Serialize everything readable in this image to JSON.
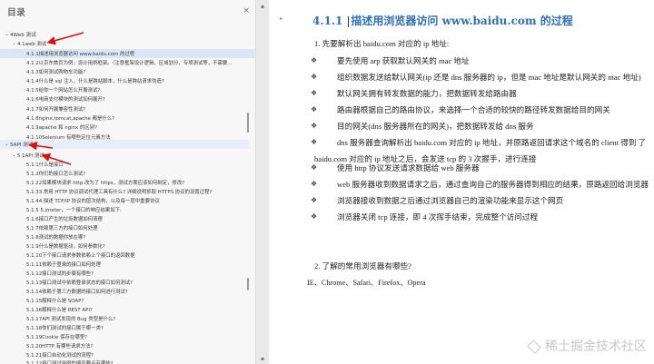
{
  "sidebar": {
    "title": "目录",
    "close_glyph": "×",
    "items": [
      {
        "label": "4Web 测试",
        "level": 1,
        "twisty": "v",
        "selected": false
      },
      {
        "label": "4.1web 测试",
        "level": 2,
        "twisty": "v",
        "selected": false
      },
      {
        "label": "4.1.1描述用浏览器访问 www.baidu.com 的过程",
        "level": 3,
        "twisty": "",
        "selected": true
      },
      {
        "label": "4.1.2以京东首页为例，设计用例框架。（注意框架设计逻辑，区域划分，专项测试等，不需要...",
        "level": 3,
        "twisty": "",
        "selected": false
      },
      {
        "label": "4.1.3如何测试购物车功能?",
        "level": 3,
        "twisty": "",
        "selected": false
      },
      {
        "label": "4.1.4什么是 sql 注入，什么是跨站脚本，什么是跨站请求伪造?",
        "level": 3,
        "twisty": "",
        "selected": false
      },
      {
        "label": "4.1.5给你一个网站怎么开展测试?",
        "level": 3,
        "twisty": "",
        "selected": false
      },
      {
        "label": "4.1.6电商支付模块的测试如何展开?",
        "level": 3,
        "twisty": "",
        "selected": false
      },
      {
        "label": "4.1.7如何开展兼容性测试?",
        "level": 3,
        "twisty": "",
        "selected": false
      },
      {
        "label": "4.1.8nginx,tomcat,apache 都是什么?",
        "level": 3,
        "twisty": "",
        "selected": false
      },
      {
        "label": "4.1.9apache 和 nginx 的区别?",
        "level": 3,
        "twisty": "",
        "selected": false
      },
      {
        "label": "4.1.10Selenium 有哪些定位元素方法",
        "level": 3,
        "twisty": "",
        "selected": false
      },
      {
        "label": "5API 测试",
        "level": 1,
        "twisty": "v",
        "selected": false,
        "hl": true
      },
      {
        "label": "5.1API 测试",
        "level": 2,
        "twisty": "v",
        "selected": false
      },
      {
        "label": "5.1.1什么是接口",
        "level": 3,
        "twisty": "",
        "selected": false
      },
      {
        "label": "5.1.2你们的接口怎么测试?",
        "level": 3,
        "twisty": "",
        "selected": false
      },
      {
        "label": "5.1.22如果模块请求 http 改为了 https，测试方案应该如何制定，修改?",
        "level": 3,
        "twisty": "",
        "selected": false
      },
      {
        "label": "5.1.33.常用 HTTP 协议调试代理工具有什么? 详细说明抓取 HTTPS 协议的设置过程?",
        "level": 3,
        "twisty": "",
        "selected": false
      },
      {
        "label": "5.1.44.描述 TCP/IP 协议的层次结构，以及每一层中重要协议",
        "level": 3,
        "twisty": "",
        "selected": false
      },
      {
        "label": "5.1.5 5.jmeter，一个接口的响应结果如下:",
        "level": 3,
        "twisty": "",
        "selected": false
      },
      {
        "label": "5.1.6接口产生的垃圾数据如何清理",
        "level": 3,
        "twisty": "",
        "selected": false
      },
      {
        "label": "5.1.7依赖第三方的接口如何处理",
        "level": 3,
        "twisty": "",
        "selected": false
      },
      {
        "label": "5.1.8测试的数据你放在哪?",
        "level": 3,
        "twisty": "",
        "selected": false
      },
      {
        "label": "5.1.9什么是数据驱动，如何参数化?",
        "level": 3,
        "twisty": "",
        "selected": false
      },
      {
        "label": "5.1.10下个接口请求参数依赖上个接口的返回数据",
        "level": 3,
        "twisty": "",
        "selected": false
      },
      {
        "label": "5.1.11依赖于登录的接口如何处理",
        "level": 3,
        "twisty": "",
        "selected": false
      },
      {
        "label": "5.1.12接口测试的步骤有哪些?",
        "level": 3,
        "twisty": "",
        "selected": false
      },
      {
        "label": "5.1.13接口测试中依赖登录状态的接口如何测试?",
        "level": 3,
        "twisty": "",
        "selected": false
      },
      {
        "label": "5.1.14依赖于第三方数据的接口如何进行测试?",
        "level": 3,
        "twisty": "",
        "selected": false
      },
      {
        "label": "5.1.15解释什么是 SOAP?",
        "level": 3,
        "twisty": "",
        "selected": false
      },
      {
        "label": "5.1.16解释什么是 REST API?",
        "level": 3,
        "twisty": "",
        "selected": false
      },
      {
        "label": "5.1.17API 测试发现的 Bug 类型是什么?",
        "level": 3,
        "twisty": "",
        "selected": false
      },
      {
        "label": "5.1.18你们测试的接口属于哪一类?",
        "level": 3,
        "twisty": "",
        "selected": false
      },
      {
        "label": "5.1.19Cookie 保存在哪里?",
        "level": 3,
        "twisty": "",
        "selected": false
      },
      {
        "label": "5.1.20HTTP 有哪些请求方法?",
        "level": 3,
        "twisty": "",
        "selected": false
      },
      {
        "label": "5.1.21接口自动化测试的流程?",
        "level": 3,
        "twisty": "",
        "selected": false
      },
      {
        "label": "5.1.22接口测试用例的编写要点有哪些?",
        "level": 3,
        "twisty": "",
        "selected": false
      }
    ]
  },
  "document": {
    "heading_number": "4.1.1",
    "heading_text": "描述用浏览器访问 www.baidu.com 的过程",
    "step1": "1.  先要解析出  baidu.com  对应的 ip  地址:",
    "bullets": [
      "要先使用  arp  获取默认网关的  mac  地址",
      "组织数据发送给默认网关(ip  还是  dns  服务器的 ip，但是  mac  地址是默认网关的  mac  地址)",
      "默认网关拥有转发数据的能力，把数据转发给路由器",
      "路由器根据自己的路由协议，来选择一个合适的较快的路径转发数据给目的网关",
      "目的网关(dns  服务器所在的网关)，把数据转发给  dns  服务",
      "dns  服务器查询解析出  baidu.com  对应的 ip  地址，并原路返回请求这个域名的  client  得到  了",
      "使用  http  协议发送请求数据给 web  服务器",
      "web  服务器收到数据请求之后，通过查询自己的服务器得到相应的结果，原路返回给浏览器",
      "浏览器接收到数据之后通过浏览器自己的渲染功能来显示这个网页",
      "浏览器关闭 tcp  连接，即  4  次挥手结束，完成整个访问过程"
    ],
    "bullet_glyph": "❖",
    "cont_line": "baidu.com  对应的 ip  地址之后，会发送 tcp  的  3  次握手，进行连接",
    "step2": "2.  了解的常用浏览器有哪些?",
    "browsers": "IE、Chrome、Safari、Firefox、Opera",
    "watermark": "稀土掘金技术社区"
  },
  "colors": {
    "heading": "#2f6fb8",
    "selection": "#dbe7f6",
    "arrow": "#e01010"
  }
}
